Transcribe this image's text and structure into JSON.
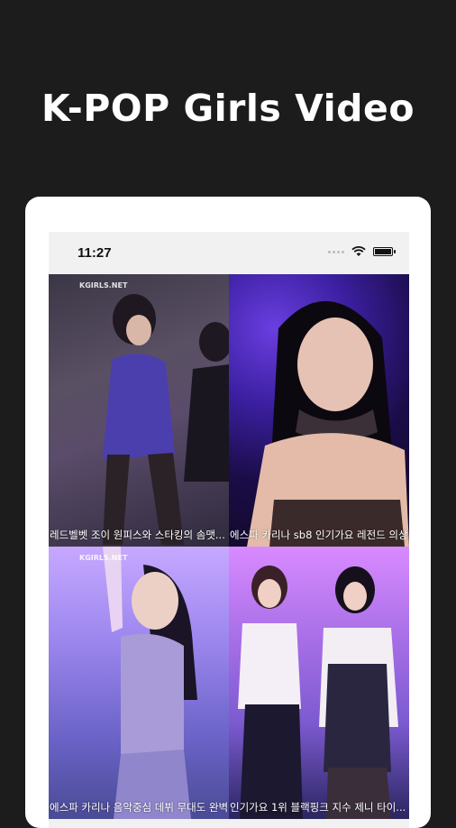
{
  "headline": "K-POP Girls Video",
  "status_bar": {
    "time": "11:27"
  },
  "videos": [
    {
      "title": "레드벨벳 조이 원피스와 스타킹의 솜맷...",
      "watermark": "KGIRLS.NET"
    },
    {
      "title": "에스파 카리나 sb8 인기가요 레전드 의상",
      "watermark": ""
    },
    {
      "title": "에스파 카리나 음악중심 데뷔 무대도 완벽",
      "watermark": "KGIRLS.NET"
    },
    {
      "title": "인기가요 1위 블랙핑크 지수 제니 타이...",
      "watermark": ""
    }
  ],
  "colors": {
    "background": "#1c1c1c",
    "device": "#ffffff",
    "status_bar": "#f1f1f1"
  }
}
